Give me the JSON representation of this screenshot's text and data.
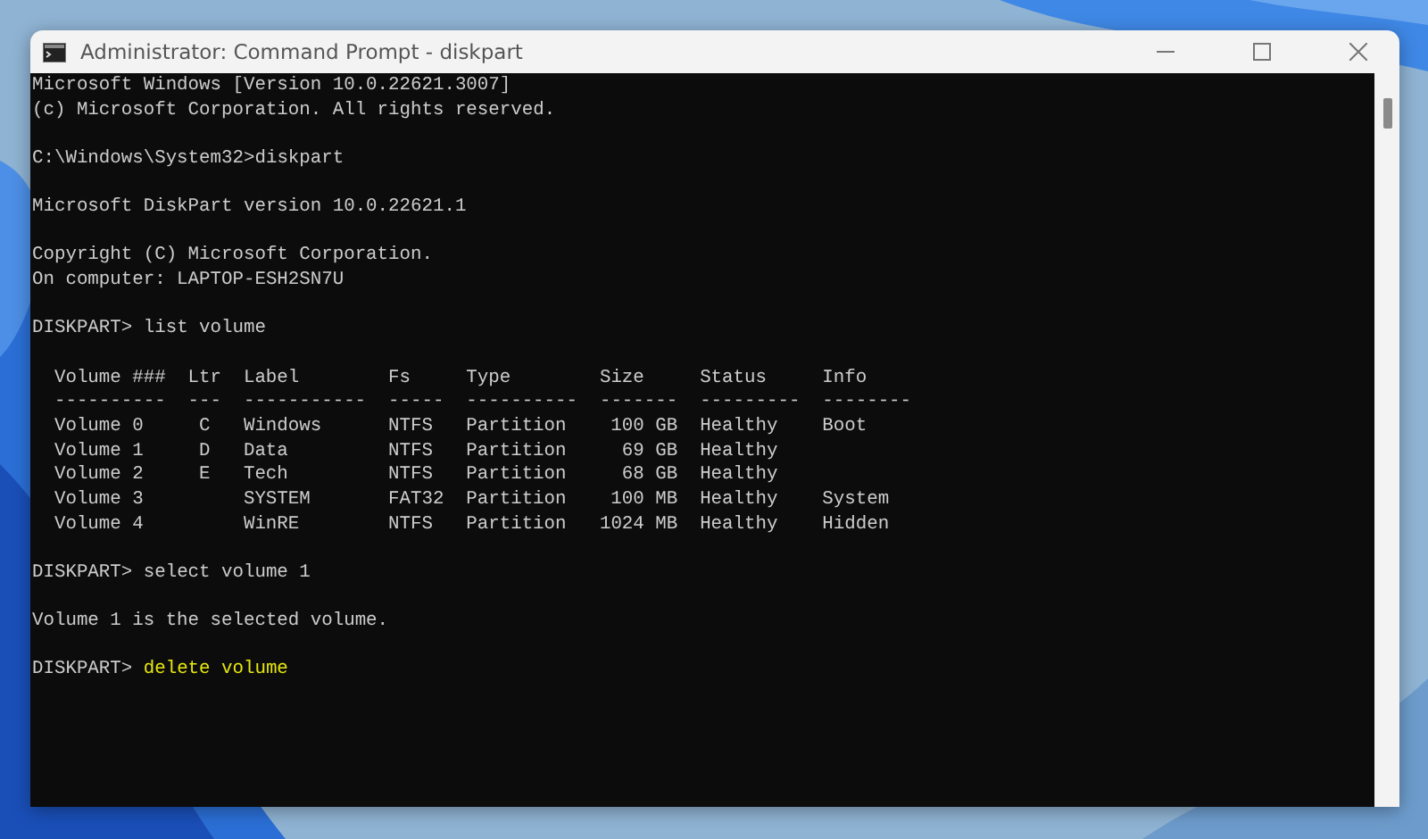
{
  "window": {
    "title": "Administrator: Command Prompt - diskpart"
  },
  "console": [
    {
      "kind": "text",
      "text": "Microsoft Windows [Version 10.0.22621.3007]"
    },
    {
      "kind": "text",
      "text": "(c) Microsoft Corporation. All rights reserved."
    },
    {
      "kind": "blank"
    },
    {
      "kind": "prompt",
      "prompt": "C:\\Windows\\System32>",
      "command": "diskpart",
      "current": false
    },
    {
      "kind": "blank"
    },
    {
      "kind": "text",
      "text": "Microsoft DiskPart version 10.0.22621.1"
    },
    {
      "kind": "blank"
    },
    {
      "kind": "text",
      "text": "Copyright (C) Microsoft Corporation."
    },
    {
      "kind": "text",
      "text": "On computer: LAPTOP-ESH2SN7U"
    },
    {
      "kind": "blank"
    },
    {
      "kind": "prompt",
      "prompt": "DISKPART> ",
      "command": "list volume",
      "current": false
    },
    {
      "kind": "blank"
    },
    {
      "kind": "table",
      "columns": [
        {
          "label": "Volume ###",
          "rule": "----------"
        },
        {
          "label": "Ltr",
          "rule": "---"
        },
        {
          "label": "Label",
          "rule": "-----------"
        },
        {
          "label": "Fs",
          "rule": "-----"
        },
        {
          "label": "Type",
          "rule": "----------"
        },
        {
          "label": "Size",
          "rule": "-------"
        },
        {
          "label": "Status",
          "rule": "---------"
        },
        {
          "label": "Info",
          "rule": "--------"
        }
      ],
      "rows": [
        [
          "Volume 0",
          "C",
          "Windows",
          "NTFS",
          "Partition",
          "100 GB",
          "Healthy",
          "Boot"
        ],
        [
          "Volume 1",
          "D",
          "Data",
          "NTFS",
          "Partition",
          "69 GB",
          "Healthy",
          ""
        ],
        [
          "Volume 2",
          "E",
          "Tech",
          "NTFS",
          "Partition",
          "68 GB",
          "Healthy",
          ""
        ],
        [
          "Volume 3",
          "",
          "SYSTEM",
          "FAT32",
          "Partition",
          "100 MB",
          "Healthy",
          "System"
        ],
        [
          "Volume 4",
          "",
          "WinRE",
          "NTFS",
          "Partition",
          "1024 MB",
          "Healthy",
          "Hidden"
        ]
      ]
    },
    {
      "kind": "blank"
    },
    {
      "kind": "prompt",
      "prompt": "DISKPART> ",
      "command": "select volume 1",
      "current": false
    },
    {
      "kind": "blank"
    },
    {
      "kind": "text",
      "text": "Volume 1 is the selected volume."
    },
    {
      "kind": "blank"
    },
    {
      "kind": "prompt",
      "prompt": "DISKPART> ",
      "command": "delete volume",
      "current": true
    }
  ]
}
